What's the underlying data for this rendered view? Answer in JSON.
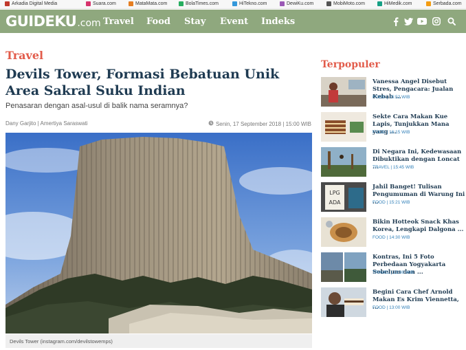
{
  "network": {
    "items": [
      {
        "label": "Arkadia Digital Media",
        "color": "#c0392b"
      },
      {
        "label": "Suara.com",
        "color": "#d6336c"
      },
      {
        "label": "MataMata.com",
        "color": "#e67e22"
      },
      {
        "label": "BolaTimes.com",
        "color": "#27ae60"
      },
      {
        "label": "HiTekno.com",
        "color": "#3498db"
      },
      {
        "label": "DewiKu.com",
        "color": "#9b59b6"
      },
      {
        "label": "MobiMoto.com",
        "color": "#555555"
      },
      {
        "label": "HiMedik.com",
        "color": "#16a085"
      },
      {
        "label": "Serbada.com",
        "color": "#f39c12"
      }
    ]
  },
  "nav": {
    "brand_main": "GUIDEKU",
    "brand_tld": ".com",
    "links": [
      "Travel",
      "Food",
      "Stay",
      "Event",
      "Indeks"
    ],
    "icons": [
      "facebook-icon",
      "twitter-icon",
      "youtube-icon",
      "instagram-icon",
      "search-icon"
    ],
    "color": "#8fa87e"
  },
  "article": {
    "section": "Travel",
    "title": "Devils Tower, Formasi Bebatuan Unik Area Sakral Suku Indian",
    "subtitle": "Penasaran dengan asal-usul di balik nama seramnya?",
    "byline": "Dany Garjito | Amertiya Saraswati",
    "date": "Senin, 17 September 2018 | 15:00 WIB",
    "caption": "Devils Tower (instagram.com/devilstowemps)"
  },
  "sidebar": {
    "title": "Terpopuler",
    "items": [
      {
        "title": "Vanessa Angel Disebut Stres, Pengacara: Jualan Kebab ...",
        "meta": "FOOD | 15:52 WIB"
      },
      {
        "title": "Sekte Cara Makan Kue Lapis, Tunjukkan Mana yang ...",
        "meta": "FOOD | 16:15 WIB"
      },
      {
        "title": "Di Negara Ini, Kedewasaan Dibuktikan dengan Loncat ...",
        "meta": "TRAVEL | 15:45 WIB"
      },
      {
        "title": "Jahil Banget! Tulisan Pengumuman di Warung Ini ...",
        "meta": "FOOD | 15:21 WIB"
      },
      {
        "title": "Bikin Hotteok Snack Khas Korea, Lengkapi Dalgona ...",
        "meta": "FOOD | 14:30 WIB"
      },
      {
        "title": "Kontras, Ini 5 Foto Perbedaan Yogyakarta Sebelum dan ...",
        "meta": "TRAVEL | 13:30 WIB"
      },
      {
        "title": "Begini Cara Chef Arnold Makan Es Krim Viennetta, ...",
        "meta": "FOOD | 13:00 WIB"
      }
    ]
  },
  "colors": {
    "accent": "#e25b4a",
    "headline": "#1f3b52",
    "meta": "#2f7fb8"
  }
}
